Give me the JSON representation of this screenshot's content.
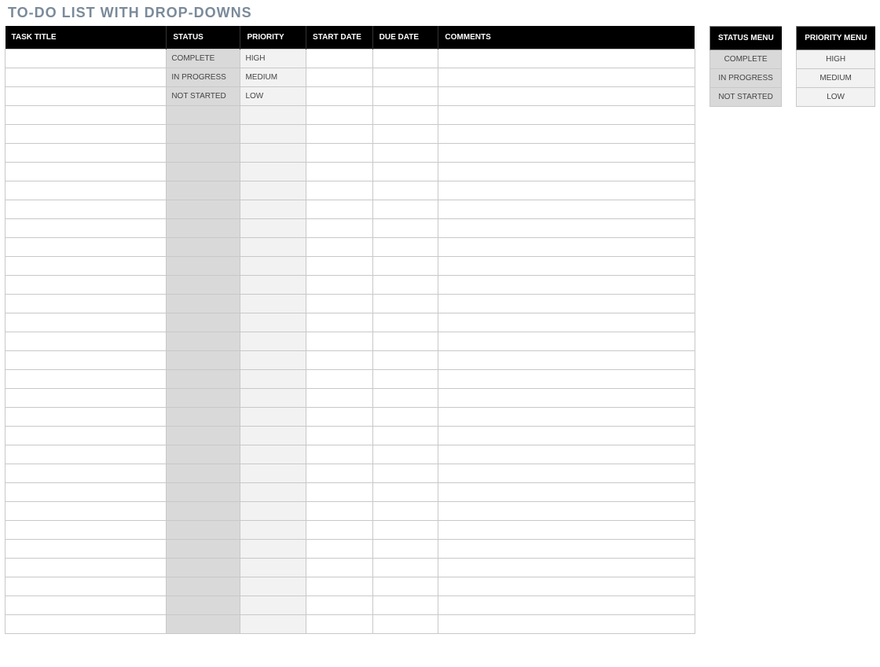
{
  "title": "TO-DO LIST WITH DROP-DOWNS",
  "main": {
    "headers": {
      "task": "TASK TITLE",
      "status": "STATUS",
      "priority": "PRIORITY",
      "start": "START DATE",
      "due": "DUE DATE",
      "comments": "COMMENTS"
    },
    "rows": [
      {
        "task": "",
        "status": "COMPLETE",
        "priority": "HIGH",
        "start": "",
        "due": "",
        "comments": ""
      },
      {
        "task": "",
        "status": "IN PROGRESS",
        "priority": "MEDIUM",
        "start": "",
        "due": "",
        "comments": ""
      },
      {
        "task": "",
        "status": "NOT STARTED",
        "priority": "LOW",
        "start": "",
        "due": "",
        "comments": ""
      },
      {
        "task": "",
        "status": "",
        "priority": "",
        "start": "",
        "due": "",
        "comments": ""
      },
      {
        "task": "",
        "status": "",
        "priority": "",
        "start": "",
        "due": "",
        "comments": ""
      },
      {
        "task": "",
        "status": "",
        "priority": "",
        "start": "",
        "due": "",
        "comments": ""
      },
      {
        "task": "",
        "status": "",
        "priority": "",
        "start": "",
        "due": "",
        "comments": ""
      },
      {
        "task": "",
        "status": "",
        "priority": "",
        "start": "",
        "due": "",
        "comments": ""
      },
      {
        "task": "",
        "status": "",
        "priority": "",
        "start": "",
        "due": "",
        "comments": ""
      },
      {
        "task": "",
        "status": "",
        "priority": "",
        "start": "",
        "due": "",
        "comments": ""
      },
      {
        "task": "",
        "status": "",
        "priority": "",
        "start": "",
        "due": "",
        "comments": ""
      },
      {
        "task": "",
        "status": "",
        "priority": "",
        "start": "",
        "due": "",
        "comments": ""
      },
      {
        "task": "",
        "status": "",
        "priority": "",
        "start": "",
        "due": "",
        "comments": ""
      },
      {
        "task": "",
        "status": "",
        "priority": "",
        "start": "",
        "due": "",
        "comments": ""
      },
      {
        "task": "",
        "status": "",
        "priority": "",
        "start": "",
        "due": "",
        "comments": ""
      },
      {
        "task": "",
        "status": "",
        "priority": "",
        "start": "",
        "due": "",
        "comments": ""
      },
      {
        "task": "",
        "status": "",
        "priority": "",
        "start": "",
        "due": "",
        "comments": ""
      },
      {
        "task": "",
        "status": "",
        "priority": "",
        "start": "",
        "due": "",
        "comments": ""
      },
      {
        "task": "",
        "status": "",
        "priority": "",
        "start": "",
        "due": "",
        "comments": ""
      },
      {
        "task": "",
        "status": "",
        "priority": "",
        "start": "",
        "due": "",
        "comments": ""
      },
      {
        "task": "",
        "status": "",
        "priority": "",
        "start": "",
        "due": "",
        "comments": ""
      },
      {
        "task": "",
        "status": "",
        "priority": "",
        "start": "",
        "due": "",
        "comments": ""
      },
      {
        "task": "",
        "status": "",
        "priority": "",
        "start": "",
        "due": "",
        "comments": ""
      },
      {
        "task": "",
        "status": "",
        "priority": "",
        "start": "",
        "due": "",
        "comments": ""
      },
      {
        "task": "",
        "status": "",
        "priority": "",
        "start": "",
        "due": "",
        "comments": ""
      },
      {
        "task": "",
        "status": "",
        "priority": "",
        "start": "",
        "due": "",
        "comments": ""
      },
      {
        "task": "",
        "status": "",
        "priority": "",
        "start": "",
        "due": "",
        "comments": ""
      },
      {
        "task": "",
        "status": "",
        "priority": "",
        "start": "",
        "due": "",
        "comments": ""
      },
      {
        "task": "",
        "status": "",
        "priority": "",
        "start": "",
        "due": "",
        "comments": ""
      },
      {
        "task": "",
        "status": "",
        "priority": "",
        "start": "",
        "due": "",
        "comments": ""
      },
      {
        "task": "",
        "status": "",
        "priority": "",
        "start": "",
        "due": "",
        "comments": ""
      }
    ]
  },
  "status_menu": {
    "header": "STATUS MENU",
    "items": [
      "COMPLETE",
      "IN PROGRESS",
      "NOT STARTED"
    ]
  },
  "priority_menu": {
    "header": "PRIORITY MENU",
    "items": [
      "HIGH",
      "MEDIUM",
      "LOW"
    ]
  }
}
